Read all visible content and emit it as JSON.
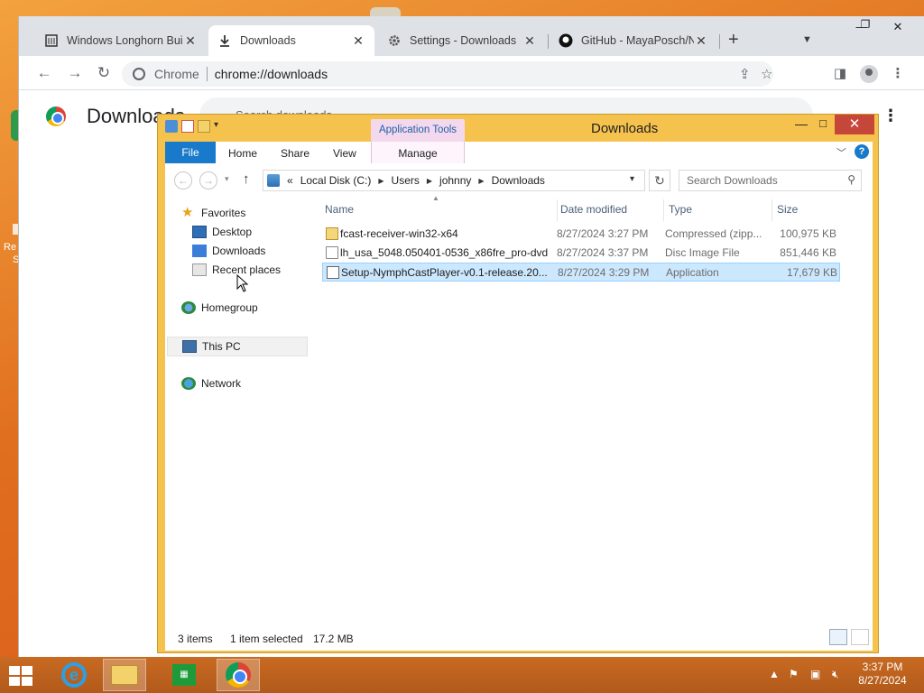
{
  "chrome": {
    "tabs": [
      {
        "title": "Windows Longhorn Bui",
        "close": "✕",
        "icon": "page-icon"
      },
      {
        "title": "Downloads",
        "close": "✕",
        "icon": "download-icon"
      },
      {
        "title": "Settings - Downloads",
        "close": "✕",
        "icon": "gear-icon"
      },
      {
        "title": "GitHub - MayaPosch/N",
        "close": "✕",
        "icon": "github-icon"
      }
    ],
    "new_tab": "+",
    "omnibox": {
      "site_label": "Chrome",
      "url": "chrome://downloads"
    },
    "page_title": "Downloads",
    "search_placeholder": "Search downloads"
  },
  "explorer": {
    "title": "Downloads",
    "contextual_tab": "Application Tools",
    "ribbon_tabs": [
      "File",
      "Home",
      "Share",
      "View",
      "Manage"
    ],
    "breadcrumb": [
      "Local Disk (C:)",
      "Users",
      "johnny",
      "Downloads"
    ],
    "breadcrumb_prefix": "«",
    "search_placeholder": "Search Downloads",
    "nav_pane": {
      "favorites": "Favorites",
      "fav_items": [
        "Desktop",
        "Downloads",
        "Recent places"
      ],
      "homegroup": "Homegroup",
      "this_pc": "This PC",
      "network": "Network"
    },
    "columns": [
      "Name",
      "Date modified",
      "Type",
      "Size"
    ],
    "files": [
      {
        "name": "fcast-receiver-win32-x64",
        "date": "8/27/2024 3:27 PM",
        "type": "Compressed (zipp...",
        "size": "100,975 KB",
        "icon": "zip-folder-icon"
      },
      {
        "name": "lh_usa_5048.050401-0536_x86fre_pro-dvd",
        "date": "8/27/2024 3:37 PM",
        "type": "Disc Image File",
        "size": "851,446 KB",
        "icon": "disc-image-icon"
      },
      {
        "name": "Setup-NymphCastPlayer-v0.1-release.20...",
        "date": "8/27/2024 3:29 PM",
        "type": "Application",
        "size": "17,679 KB",
        "icon": "installer-icon"
      }
    ],
    "status": {
      "items": "3 items",
      "selected": "1 item selected",
      "size": "17.2 MB"
    }
  },
  "taskbar": {
    "time": "3:37 PM",
    "date": "8/27/2024"
  },
  "colors": {
    "explorer_frame": "#f6c24e",
    "selection": "#cce8ff",
    "close_red": "#c7463a",
    "file_tab": "#1979ca"
  }
}
